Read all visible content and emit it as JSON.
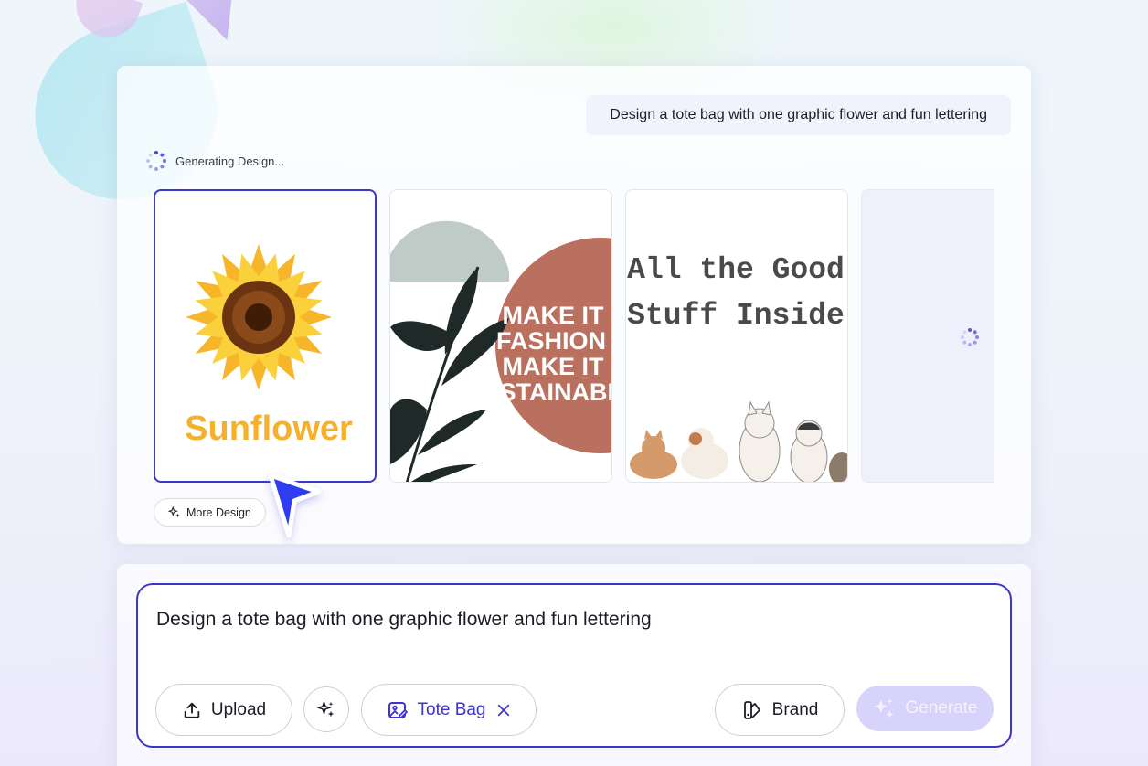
{
  "chat": {
    "prompt_bubble": "Design a tote bag with one graphic flower and fun lettering",
    "status_text": "Generating Design..."
  },
  "designs": [
    {
      "text": "Sunflower",
      "selected": true
    },
    {
      "text_lines": [
        "MAKE IT",
        "FASHION",
        "MAKE IT",
        "SUSTAINABL"
      ]
    },
    {
      "text_lines": [
        "All the Good",
        "Stuff Inside"
      ]
    },
    {
      "state": "loading"
    }
  ],
  "more_design_label": "More Design",
  "composer": {
    "input_value": "Design a tote bag with one graphic flower and fun lettering",
    "upload_label": "Upload",
    "product_tag": "Tote Bag",
    "brand_label": "Brand",
    "generate_label": "Generate"
  },
  "colors": {
    "accent": "#3d37c9",
    "generate_disabled": "#d7d3fb",
    "sunflower_text": "#f6b02a"
  }
}
